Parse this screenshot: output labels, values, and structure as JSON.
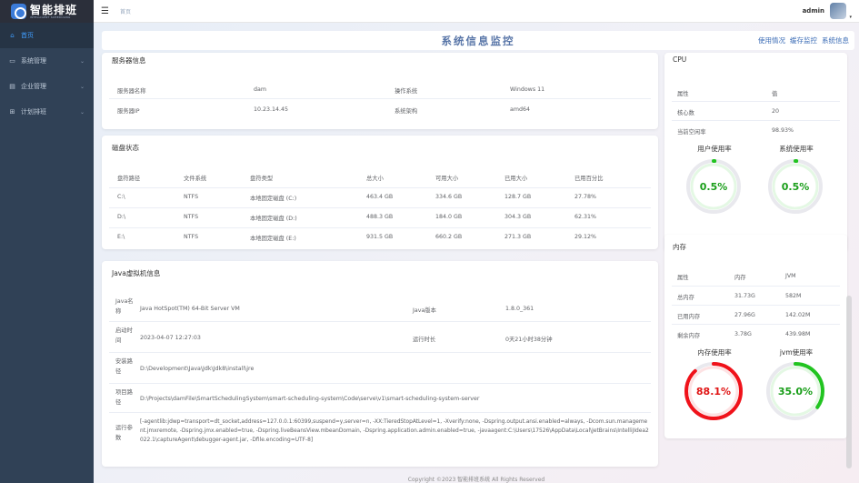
{
  "app": {
    "logo_title": "智能排班",
    "logo_sub": "INTELLIGENT SCHEDULING"
  },
  "sidebar": {
    "items": [
      {
        "label": "首页",
        "icon": "home-icon"
      },
      {
        "label": "系统管理",
        "icon": "monitor-icon"
      },
      {
        "label": "企业管理",
        "icon": "building-icon"
      },
      {
        "label": "计划排班",
        "icon": "schedule-icon"
      }
    ]
  },
  "header": {
    "breadcrumb": "首页",
    "user": "admin"
  },
  "page": {
    "title": "系统信息监控",
    "links": [
      "使用情况",
      "缓存监控",
      "系统信息"
    ]
  },
  "server": {
    "title": "服务器信息",
    "rows": [
      [
        "服务器名称",
        "dam",
        "操作系统",
        "Windows 11"
      ],
      [
        "服务器IP",
        "10.23.14.45",
        "系统架构",
        "amd64"
      ]
    ]
  },
  "disk": {
    "title": "磁盘状态",
    "headers": [
      "盘符路径",
      "文件系统",
      "盘符类型",
      "总大小",
      "可用大小",
      "已用大小",
      "已用百分比"
    ],
    "rows": [
      [
        "C:\\",
        "NTFS",
        "本地固定磁盘 (C:)",
        "463.4 GB",
        "334.6 GB",
        "128.7 GB",
        "27.78%"
      ],
      [
        "D:\\",
        "NTFS",
        "本地固定磁盘 (D:)",
        "488.3 GB",
        "184.0 GB",
        "304.3 GB",
        "62.31%"
      ],
      [
        "E:\\",
        "NTFS",
        "本地固定磁盘 (E:)",
        "931.5 GB",
        "660.2 GB",
        "271.3 GB",
        "29.12%"
      ]
    ]
  },
  "jvm": {
    "title": "Java虚拟机信息",
    "name_label": "Java名称",
    "name_value": "Java HotSpot(TM) 64-Bit Server VM",
    "version_label": "Java版本",
    "version_value": "1.8.0_361",
    "start_label": "启动时间",
    "start_value": "2023-04-07 12:27:03",
    "runtime_label": "运行时长",
    "runtime_value": "0天21小时38分钟",
    "install_label": "安装路径",
    "install_value": "D:\\Development\\Java\\Jdk\\Jdk8\\install\\jre",
    "project_label": "项目路径",
    "project_value": "D:\\Projects\\damFile\\SmartSchedulingSystem\\smart-scheduling-system\\Code\\serve\\v1\\smart-scheduling-system-server",
    "args_label": "运行参数",
    "args_value": "[-agentlib:jdwp=transport=dt_socket,address=127.0.0.1:60399,suspend=y,server=n, -XX:TieredStopAtLevel=1, -Xverify:none, -Dspring.output.ansi.enabled=always, -Dcom.sun.management.jmxremote, -Dspring.jmx.enabled=true, -Dspring.liveBeansView.mbeanDomain, -Dspring.application.admin.enabled=true, -javaagent:C:\\Users\\17526\\AppData\\Local\\JetBrains\\IntelliJIdea2022.1\\captureAgent\\debugger-agent.jar, -Dfile.encoding=UTF-8]"
  },
  "cpu": {
    "title": "CPU",
    "headers": [
      "属性",
      "值"
    ],
    "rows": [
      [
        "核心数",
        "20"
      ],
      [
        "当前空闲率",
        "98.93%"
      ]
    ],
    "user_usage_label": "用户使用率",
    "user_usage_value": "0.5%",
    "user_usage_ratio": 0.005,
    "sys_usage_label": "系统使用率",
    "sys_usage_value": "0.5%",
    "sys_usage_ratio": 0.005
  },
  "memory": {
    "title": "内存",
    "headers": [
      "属性",
      "内存",
      "JVM"
    ],
    "rows": [
      [
        "总内存",
        "31.73G",
        "582M"
      ],
      [
        "已用内存",
        "27.96G",
        "142.02M"
      ],
      [
        "剩余内存",
        "3.78G",
        "439.98M"
      ]
    ],
    "mem_usage_label": "内存使用率",
    "mem_usage_value": "88.1%",
    "mem_usage_ratio": 0.881,
    "jvm_usage_label": "jvm使用率",
    "jvm_usage_value": "35.0%",
    "jvm_usage_ratio": 0.35
  },
  "colors": {
    "ring_green": "#21c420",
    "ring_red": "#f0121a",
    "ring_track": "#e9e9ee",
    "ring_inner": "#ffffff"
  },
  "footer": "Copyright ©2023 智能排班系统 All Rights Reserved"
}
